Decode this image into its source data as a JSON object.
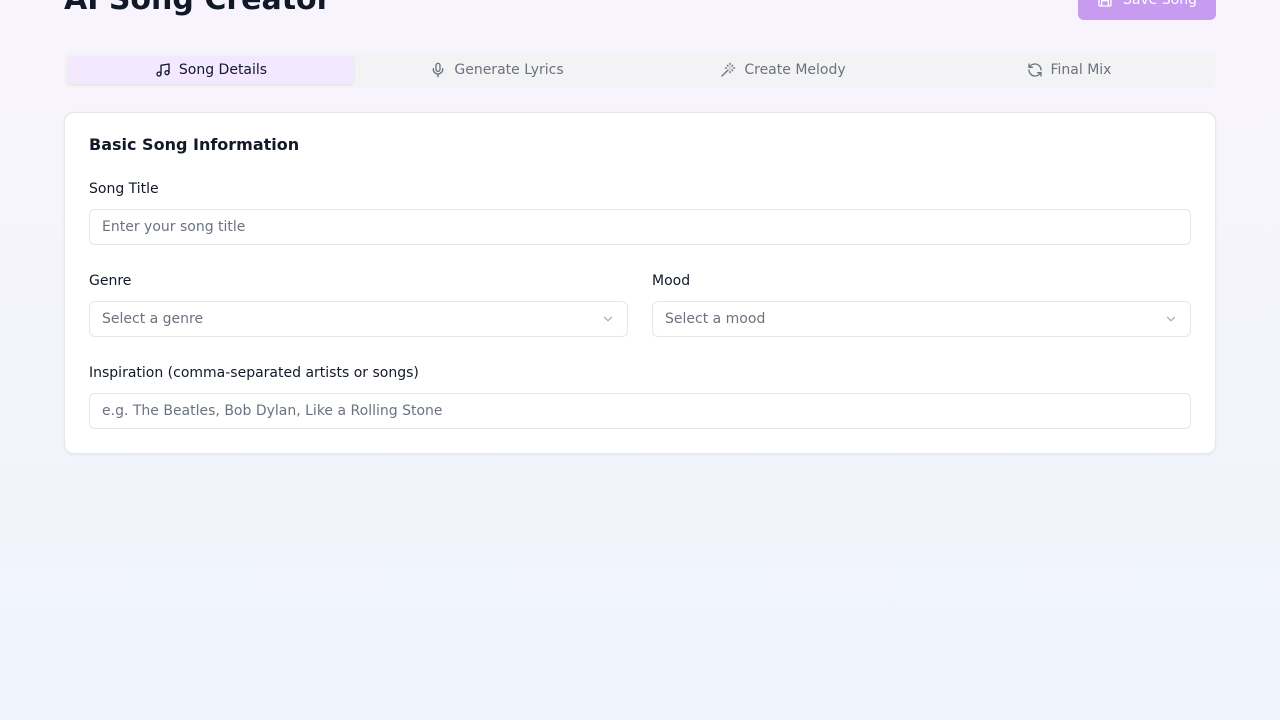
{
  "header": {
    "title": "AI Song Creator",
    "save_label": "Save Song"
  },
  "tabs": [
    {
      "label": "Song Details",
      "icon": "music-note-icon",
      "active": true
    },
    {
      "label": "Generate Lyrics",
      "icon": "microphone-icon",
      "active": false
    },
    {
      "label": "Create Melody",
      "icon": "magic-wand-icon",
      "active": false
    },
    {
      "label": "Final Mix",
      "icon": "refresh-icon",
      "active": false
    }
  ],
  "card": {
    "title": "Basic Song Information",
    "song_title": {
      "label": "Song Title",
      "placeholder": "Enter your song title",
      "value": ""
    },
    "genre": {
      "label": "Genre",
      "placeholder": "Select a genre"
    },
    "mood": {
      "label": "Mood",
      "placeholder": "Select a mood"
    },
    "inspiration": {
      "label": "Inspiration (comma-separated artists or songs)",
      "placeholder": "e.g. The Beatles, Bob Dylan, Like a Rolling Stone",
      "value": ""
    }
  },
  "colors": {
    "accent": "#c79bf0",
    "active_tab_bg": "#f3e8fd"
  }
}
